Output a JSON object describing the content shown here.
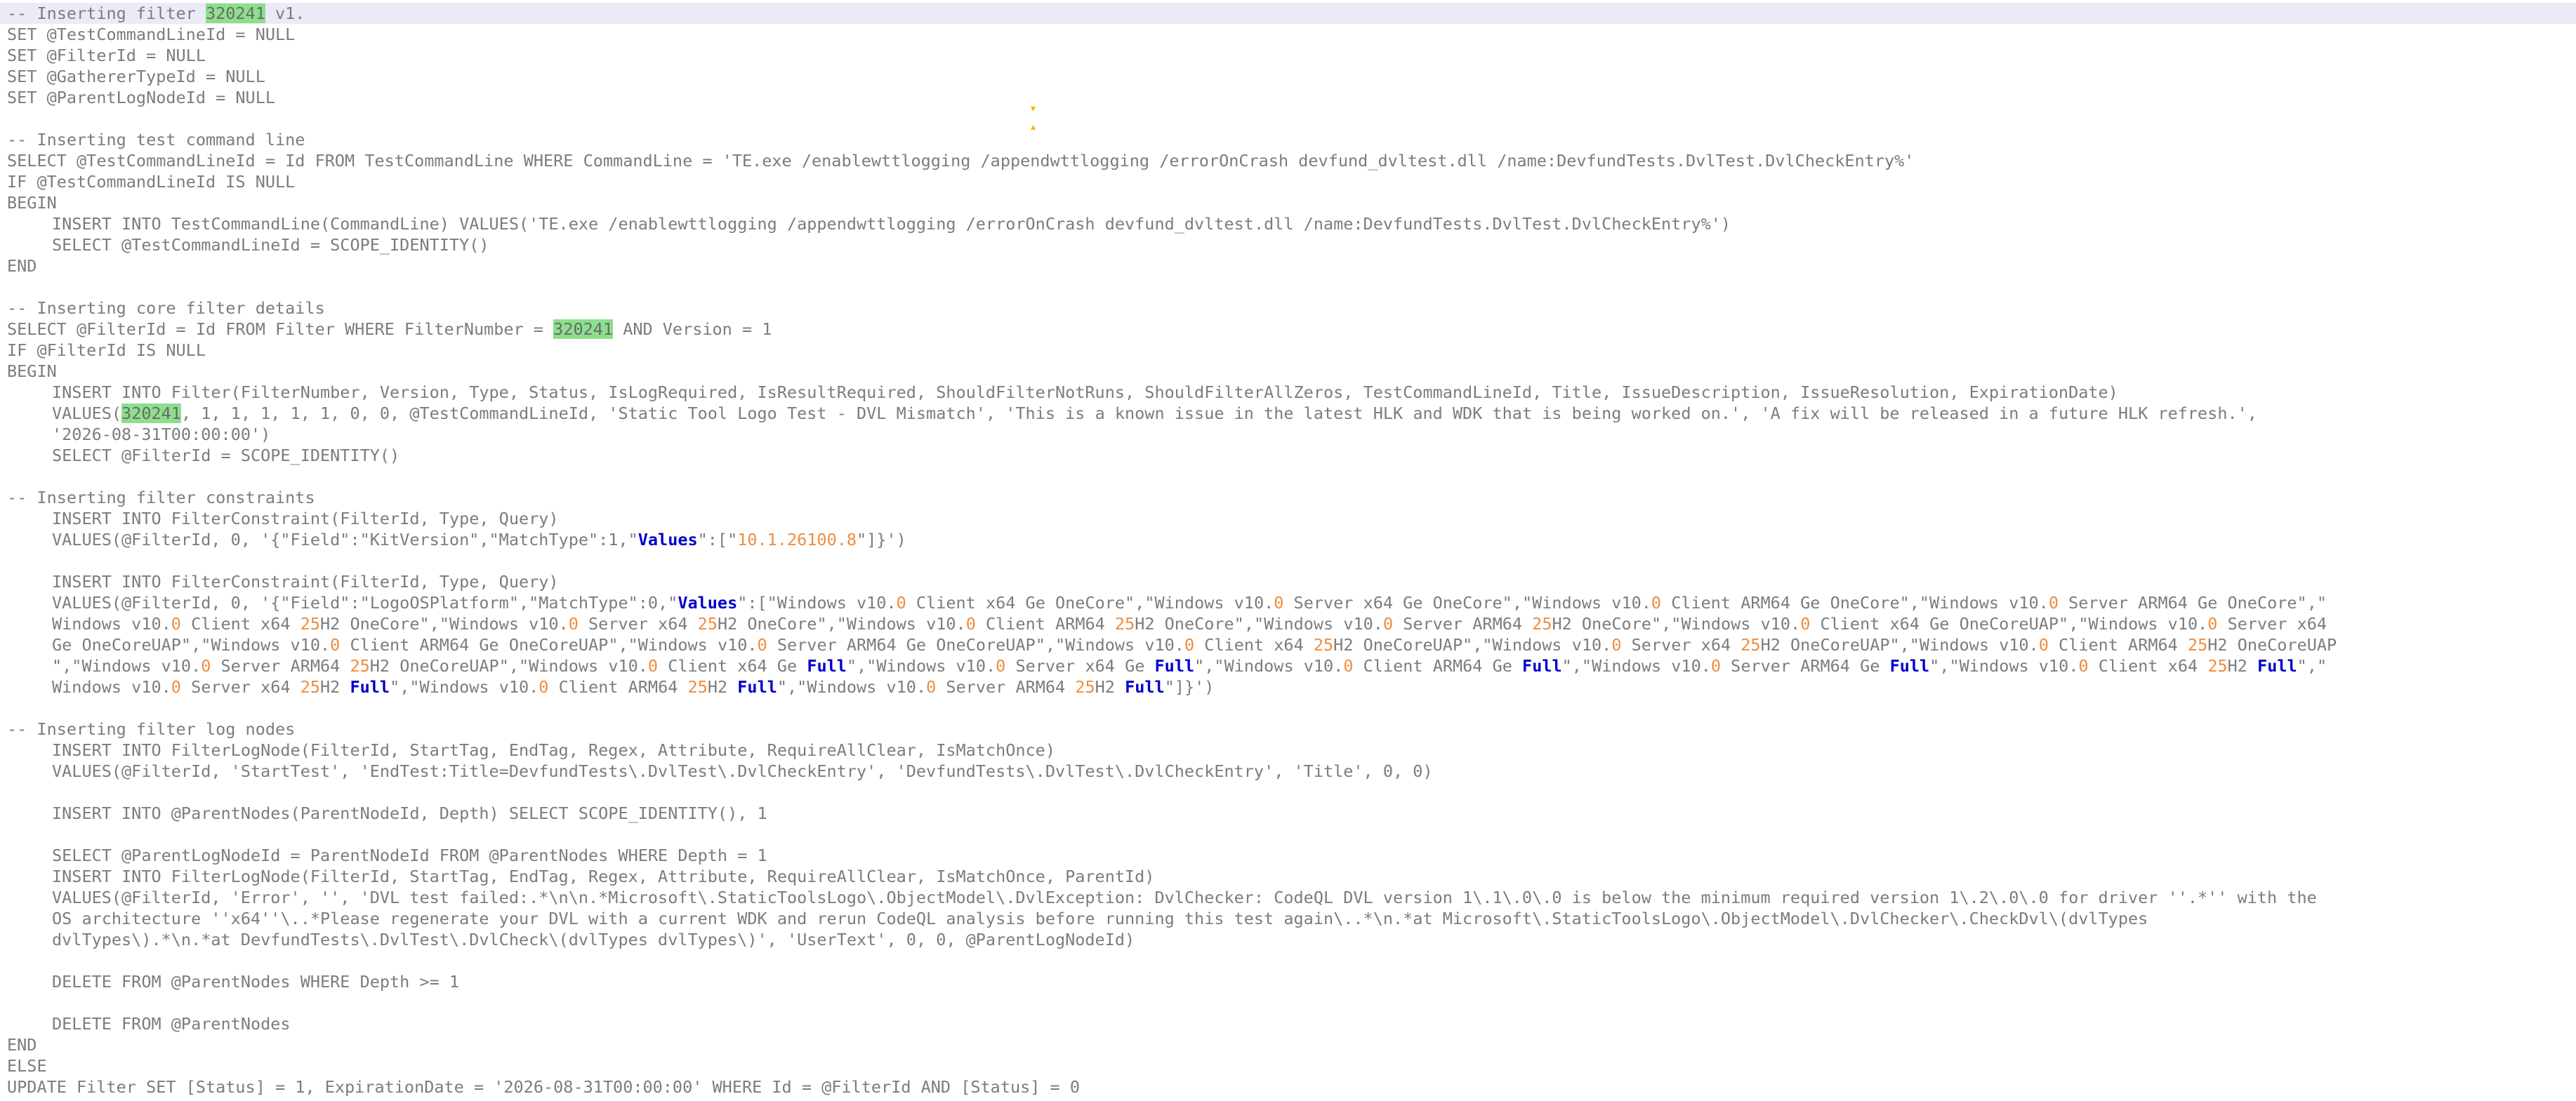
{
  "editor": {
    "current_line": 0,
    "lines": [
      [
        {
          "t": "-- Inserting filter "
        },
        {
          "t": "320241",
          "c": "hl"
        },
        {
          "t": " v1."
        }
      ],
      [
        {
          "t": "SET @TestCommandLineId = NULL"
        }
      ],
      [
        {
          "t": "SET @FilterId = NULL"
        }
      ],
      [
        {
          "t": "SET @GathererTypeId = NULL"
        }
      ],
      [
        {
          "t": "SET @ParentLogNodeId = NULL"
        }
      ],
      [],
      [
        {
          "t": "-- Inserting test command line"
        }
      ],
      [
        {
          "t": "SELECT @TestCommandLineId = Id FROM TestCommandLine WHERE CommandLine = 'TE.exe /enablewttlogging /appendwttlogging /errorOnCrash devfund_dvltest.dll /name:DevfundTests.DvlTest.DvlCheckEntry%'"
        }
      ],
      [
        {
          "t": "IF @TestCommandLineId IS NULL"
        }
      ],
      [
        {
          "t": "BEGIN"
        }
      ],
      {
        "indent": true,
        "segs": [
          {
            "t": "INSERT INTO TestCommandLine(CommandLine) VALUES('TE.exe /enablewttlogging /appendwttlogging /errorOnCrash devfund_dvltest.dll /name:DevfundTests.DvlTest.DvlCheckEntry%')"
          }
        ]
      },
      {
        "indent": true,
        "segs": [
          {
            "t": "SELECT @TestCommandLineId = SCOPE_IDENTITY()"
          }
        ]
      },
      [
        {
          "t": "END"
        }
      ],
      [],
      [
        {
          "t": "-- Inserting core filter details"
        }
      ],
      [
        {
          "t": "SELECT @FilterId = Id FROM Filter WHERE FilterNumber = "
        },
        {
          "t": "320241",
          "c": "hl"
        },
        {
          "t": " AND Version = 1"
        }
      ],
      [
        {
          "t": "IF @FilterId IS NULL"
        }
      ],
      [
        {
          "t": "BEGIN"
        }
      ],
      {
        "indent": true,
        "segs": [
          {
            "t": "INSERT INTO Filter(FilterNumber, Version, Type, Status, IsLogRequired, IsResultRequired, ShouldFilterNotRuns, ShouldFilterAllZeros, TestCommandLineId, Title, IssueDescription, IssueResolution, ExpirationDate)"
          }
        ]
      },
      {
        "indent": true,
        "segs": [
          {
            "t": "VALUES("
          },
          {
            "t": "320241",
            "c": "hl"
          },
          {
            "t": ", 1, 1, 1, 1, 1, 0, 0, @TestCommandLineId, 'Static Tool Logo Test - DVL Mismatch', 'This is a known issue in the latest HLK and WDK that is being worked on.', 'A fix will be released in a future HLK refresh.',"
          }
        ]
      },
      {
        "indent": true,
        "segs": [
          {
            "t": "'2026-08-31T00:00:00')"
          }
        ]
      },
      {
        "indent": true,
        "segs": [
          {
            "t": "SELECT @FilterId = SCOPE_IDENTITY()"
          }
        ]
      },
      [],
      [
        {
          "t": "-- Inserting filter constraints"
        }
      ],
      {
        "indent": true,
        "segs": [
          {
            "t": "INSERT INTO FilterConstraint(FilterId, Type, Query)"
          }
        ]
      },
      {
        "indent": true,
        "segs": [
          {
            "t": "VALUES(@FilterId, 0, '{\"Field\":\"KitVersion\",\"MatchType\":1,\""
          },
          {
            "t": "Values",
            "c": "kw"
          },
          {
            "t": "\":[\""
          },
          {
            "t": "10.1.26100.8",
            "c": "num"
          },
          {
            "t": "\"]}')"
          }
        ]
      },
      [],
      {
        "indent": true,
        "segs": [
          {
            "t": "INSERT INTO FilterConstraint(FilterId, Type, Query)"
          }
        ]
      },
      {
        "indent": true,
        "segs": [
          {
            "t": "VALUES(@FilterId, 0, '{\"Field\":\"LogoOSPlatform\",\"MatchType\":0,\""
          },
          {
            "t": "Values",
            "c": "kw"
          },
          {
            "t": "\":[\"Windows v10."
          },
          {
            "t": "0",
            "c": "num"
          },
          {
            "t": " Client x64 Ge OneCore\",\"Windows v10."
          },
          {
            "t": "0",
            "c": "num"
          },
          {
            "t": " Server x64 Ge OneCore\",\"Windows v10."
          },
          {
            "t": "0",
            "c": "num"
          },
          {
            "t": " Client ARM64 Ge OneCore\",\"Windows v10."
          },
          {
            "t": "0",
            "c": "num"
          },
          {
            "t": " Server ARM64 Ge OneCore\",\""
          }
        ]
      },
      {
        "indent": true,
        "segs": [
          {
            "t": "Windows v10."
          },
          {
            "t": "0",
            "c": "num"
          },
          {
            "t": " Client x64 "
          },
          {
            "t": "25",
            "c": "num"
          },
          {
            "t": "H2 OneCore\",\"Windows v10."
          },
          {
            "t": "0",
            "c": "num"
          },
          {
            "t": " Server x64 "
          },
          {
            "t": "25",
            "c": "num"
          },
          {
            "t": "H2 OneCore\",\"Windows v10."
          },
          {
            "t": "0",
            "c": "num"
          },
          {
            "t": " Client ARM64 "
          },
          {
            "t": "25",
            "c": "num"
          },
          {
            "t": "H2 OneCore\",\"Windows v10."
          },
          {
            "t": "0",
            "c": "num"
          },
          {
            "t": " Server ARM64 "
          },
          {
            "t": "25",
            "c": "num"
          },
          {
            "t": "H2 OneCore\",\"Windows v10."
          },
          {
            "t": "0",
            "c": "num"
          },
          {
            "t": " Client x64 Ge OneCoreUAP\",\"Windows v10."
          },
          {
            "t": "0",
            "c": "num"
          },
          {
            "t": " Server x64"
          }
        ]
      },
      {
        "indent": true,
        "segs": [
          {
            "t": "Ge OneCoreUAP\",\"Windows v10."
          },
          {
            "t": "0",
            "c": "num"
          },
          {
            "t": " Client ARM64 Ge OneCoreUAP\",\"Windows v10."
          },
          {
            "t": "0",
            "c": "num"
          },
          {
            "t": " Server ARM64 Ge OneCoreUAP\",\"Windows v10."
          },
          {
            "t": "0",
            "c": "num"
          },
          {
            "t": " Client x64 "
          },
          {
            "t": "25",
            "c": "num"
          },
          {
            "t": "H2 OneCoreUAP\",\"Windows v10."
          },
          {
            "t": "0",
            "c": "num"
          },
          {
            "t": " Server x64 "
          },
          {
            "t": "25",
            "c": "num"
          },
          {
            "t": "H2 OneCoreUAP\",\"Windows v10."
          },
          {
            "t": "0",
            "c": "num"
          },
          {
            "t": " Client ARM64 "
          },
          {
            "t": "25",
            "c": "num"
          },
          {
            "t": "H2 OneCoreUAP"
          }
        ]
      },
      {
        "indent": true,
        "segs": [
          {
            "t": "\",\"Windows v10."
          },
          {
            "t": "0",
            "c": "num"
          },
          {
            "t": " Server ARM64 "
          },
          {
            "t": "25",
            "c": "num"
          },
          {
            "t": "H2 OneCoreUAP\",\"Windows v10."
          },
          {
            "t": "0",
            "c": "num"
          },
          {
            "t": " Client x64 Ge "
          },
          {
            "t": "Full",
            "c": "kw"
          },
          {
            "t": "\",\"Windows v10."
          },
          {
            "t": "0",
            "c": "num"
          },
          {
            "t": " Server x64 Ge "
          },
          {
            "t": "Full",
            "c": "kw"
          },
          {
            "t": "\",\"Windows v10."
          },
          {
            "t": "0",
            "c": "num"
          },
          {
            "t": " Client ARM64 Ge "
          },
          {
            "t": "Full",
            "c": "kw"
          },
          {
            "t": "\",\"Windows v10."
          },
          {
            "t": "0",
            "c": "num"
          },
          {
            "t": " Server ARM64 Ge "
          },
          {
            "t": "Full",
            "c": "kw"
          },
          {
            "t": "\",\"Windows v10."
          },
          {
            "t": "0",
            "c": "num"
          },
          {
            "t": " Client x64 "
          },
          {
            "t": "25",
            "c": "num"
          },
          {
            "t": "H2 "
          },
          {
            "t": "Full",
            "c": "kw"
          },
          {
            "t": "\",\""
          }
        ]
      },
      {
        "indent": true,
        "segs": [
          {
            "t": "Windows v10."
          },
          {
            "t": "0",
            "c": "num"
          },
          {
            "t": " Server x64 "
          },
          {
            "t": "25",
            "c": "num"
          },
          {
            "t": "H2 "
          },
          {
            "t": "Full",
            "c": "kw"
          },
          {
            "t": "\",\"Windows v10."
          },
          {
            "t": "0",
            "c": "num"
          },
          {
            "t": " Client ARM64 "
          },
          {
            "t": "25",
            "c": "num"
          },
          {
            "t": "H2 "
          },
          {
            "t": "Full",
            "c": "kw"
          },
          {
            "t": "\",\"Windows v10."
          },
          {
            "t": "0",
            "c": "num"
          },
          {
            "t": " Server ARM64 "
          },
          {
            "t": "25",
            "c": "num"
          },
          {
            "t": "H2 "
          },
          {
            "t": "Full",
            "c": "kw"
          },
          {
            "t": "\"]}')"
          }
        ]
      },
      [],
      [
        {
          "t": "-- Inserting filter log nodes"
        }
      ],
      {
        "indent": true,
        "segs": [
          {
            "t": "INSERT INTO FilterLogNode(FilterId, StartTag, EndTag, Regex, Attribute, RequireAllClear, IsMatchOnce)"
          }
        ]
      },
      {
        "indent": true,
        "segs": [
          {
            "t": "VALUES(@FilterId, 'StartTest', 'EndTest:Title=DevfundTests\\.DvlTest\\.DvlCheckEntry', 'DevfundTests\\.DvlTest\\.DvlCheckEntry', 'Title', 0, 0)"
          }
        ]
      },
      [],
      {
        "indent": true,
        "segs": [
          {
            "t": "INSERT INTO @ParentNodes(ParentNodeId, Depth) SELECT SCOPE_IDENTITY(), 1"
          }
        ]
      },
      [],
      {
        "indent": true,
        "segs": [
          {
            "t": "SELECT @ParentLogNodeId = ParentNodeId FROM @ParentNodes WHERE Depth = 1"
          }
        ]
      },
      {
        "indent": true,
        "segs": [
          {
            "t": "INSERT INTO FilterLogNode(FilterId, StartTag, EndTag, Regex, Attribute, RequireAllClear, IsMatchOnce, ParentId)"
          }
        ]
      },
      {
        "indent": true,
        "segs": [
          {
            "t": "VALUES(@FilterId, 'Error', '', 'DVL test failed:.*\\n\\n.*Microsoft\\.StaticToolsLogo\\.ObjectModel\\.DvlException: DvlChecker: CodeQL DVL version 1\\.1\\.0\\.0 is below the minimum required version 1\\.2\\.0\\.0 for driver ''.*'' with the"
          }
        ]
      },
      {
        "indent": true,
        "segs": [
          {
            "t": "OS architecture ''x64''\\..*Please regenerate your DVL with a current WDK and rerun CodeQL analysis before running this test again\\..*\\n.*at Microsoft\\.StaticToolsLogo\\.ObjectModel\\.DvlChecker\\.CheckDvl\\(dvlTypes"
          }
        ]
      },
      {
        "indent": true,
        "segs": [
          {
            "t": "dvlTypes\\).*\\n.*at DevfundTests\\.DvlTest\\.DvlCheck\\(dvlTypes dvlTypes\\)', 'UserText', 0, 0, @ParentLogNodeId)"
          }
        ]
      },
      [],
      {
        "indent": true,
        "segs": [
          {
            "t": "DELETE FROM @ParentNodes WHERE Depth >= 1"
          }
        ]
      },
      [],
      {
        "indent": true,
        "segs": [
          {
            "t": "DELETE FROM @ParentNodes"
          }
        ]
      },
      [
        {
          "t": "END"
        }
      ],
      [
        {
          "t": "ELSE"
        }
      ],
      [
        {
          "t": "UPDATE Filter SET [Status] = 1, ExpirationDate = '2026-08-31T00:00:00' WHERE Id = @FilterId AND [Status] = 0"
        }
      ]
    ]
  }
}
